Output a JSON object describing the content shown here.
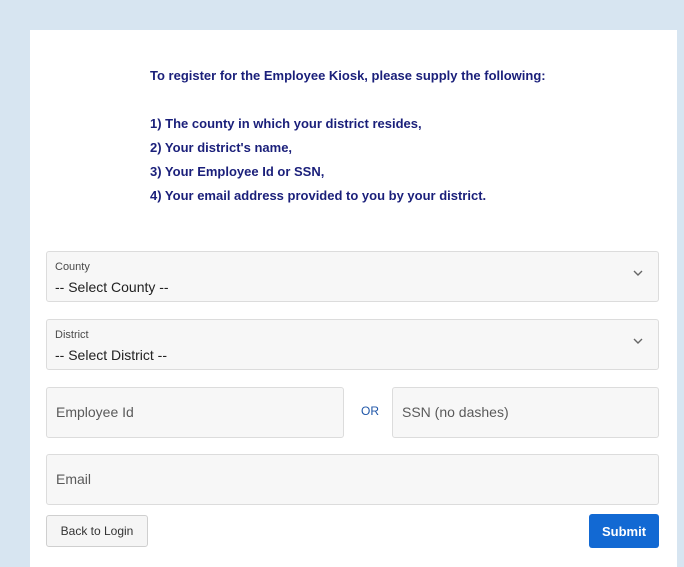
{
  "intro": {
    "heading": "To register for the Employee Kiosk, please supply the following:",
    "items": [
      "1) The county in which your district resides,",
      "2) Your district's name,",
      "3) Your Employee Id or SSN,",
      "4) Your email address provided to you by your district."
    ]
  },
  "form": {
    "county": {
      "label": "County",
      "selected": "-- Select County --"
    },
    "district": {
      "label": "District",
      "selected": "-- Select District --"
    },
    "employee_id": {
      "placeholder": "Employee Id"
    },
    "or_label": "OR",
    "ssn": {
      "placeholder": "SSN (no dashes)"
    },
    "email": {
      "placeholder": "Email"
    }
  },
  "buttons": {
    "back": "Back to Login",
    "submit": "Submit"
  },
  "colors": {
    "background": "#d7e5f1",
    "intro_text": "#1a1f7a",
    "submit": "#1269d3",
    "or_text": "#1f56a8"
  },
  "icons": {
    "dropdown": "chevron-down-icon"
  }
}
